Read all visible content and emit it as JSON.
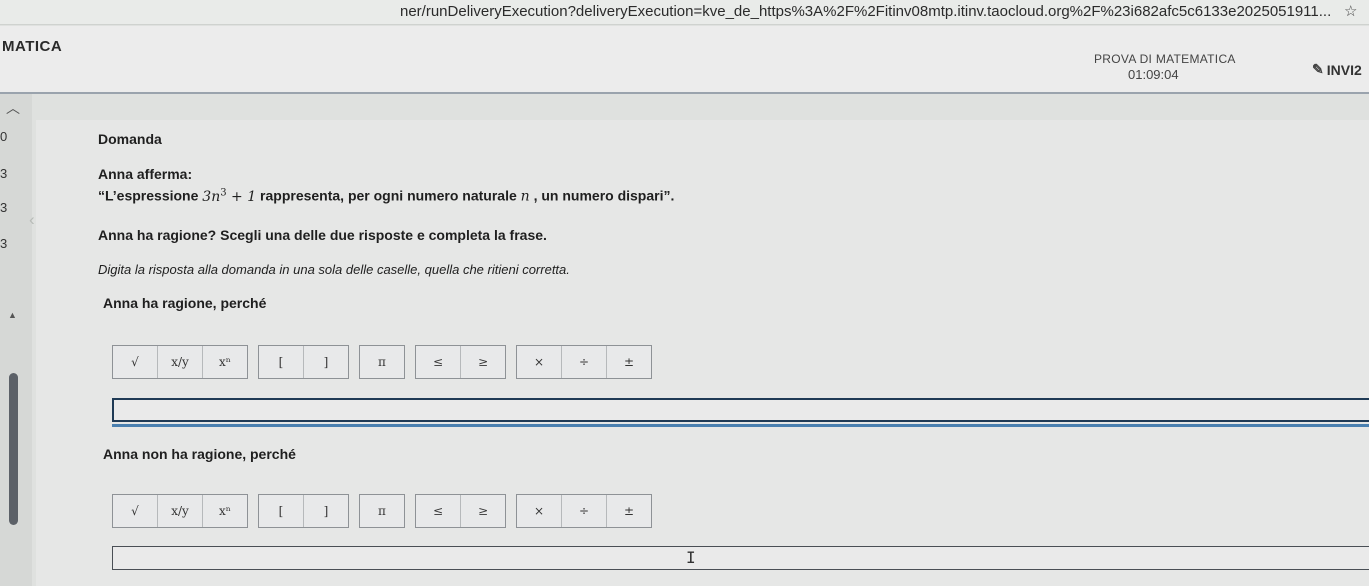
{
  "browser": {
    "url": "ner/runDeliveryExecution?deliveryExecution=kve_de_https%3A%2F%2Fitinv08mtp.itinv.taocloud.org%2F%23i682afc5c6133e2025051911..."
  },
  "header": {
    "title": "MATICA",
    "test_title": "PROVA DI MATEMATICA",
    "timer": "01:09:04",
    "submit_label": "INVI2"
  },
  "sidebar": {
    "scores": [
      "0",
      "3",
      "3",
      "3"
    ]
  },
  "question": {
    "heading": "Domanda",
    "intro": "Anna afferma:",
    "statement_pre": "“L’espressione ",
    "expr_base": "3n",
    "expr_exp": "3",
    "expr_tail": " + 1",
    "statement_mid": " rappresenta, per ogni numero naturale ",
    "var_n": "n",
    "statement_post": " , un numero dispari”.",
    "prompt": "Anna ha ragione? Scegli una delle due risposte e completa la frase.",
    "instruction": "Digita la risposta alla domanda in una sola delle caselle, quella che ritieni corretta."
  },
  "answers": [
    {
      "label": "Anna ha ragione, perché",
      "value": ""
    },
    {
      "label": "Anna non ha ragione, perché",
      "value": ""
    }
  ],
  "toolbar": {
    "sqrt": "√",
    "frac": "x/y",
    "pow": "xⁿ",
    "lbracket": "[",
    "rbracket": "]",
    "pi": "π",
    "le": "≤",
    "ge": "≥",
    "times": "×",
    "div": "÷",
    "pm": "±"
  },
  "icons": {
    "star": "star-icon",
    "submit": "pen-icon",
    "collapse": "chevron-up-icon",
    "prev": "chevron-left-icon",
    "scroll_up": "triangle-up-icon",
    "text_cursor": "text-cursor-icon"
  }
}
